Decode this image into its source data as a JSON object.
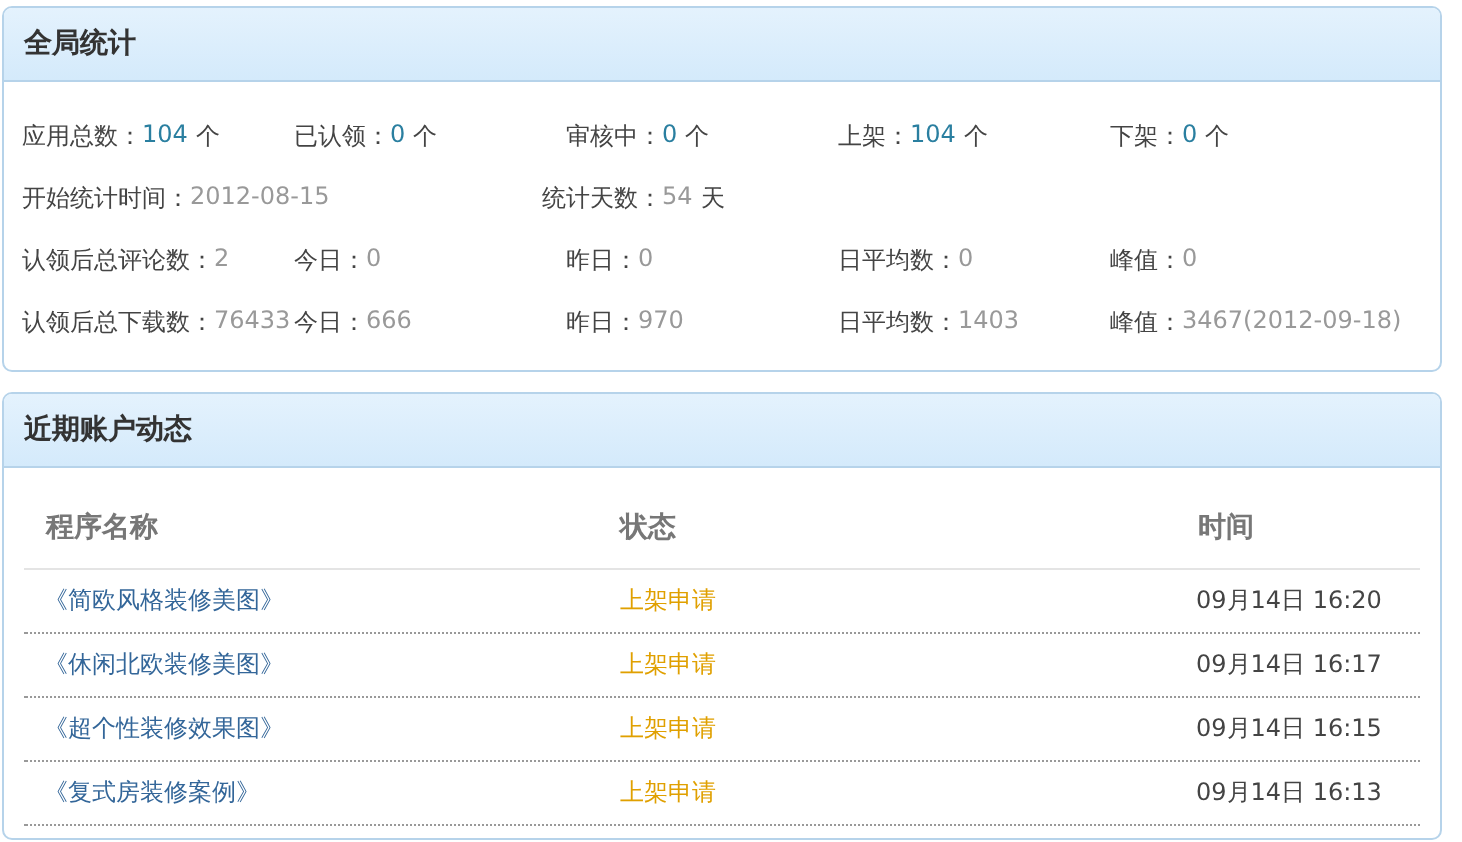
{
  "stats_panel": {
    "title": "全局统计",
    "app_counts": [
      {
        "label": "应用总数：",
        "value": "104",
        "unit": "个"
      },
      {
        "label": "已认领：",
        "value": "0",
        "unit": "个"
      },
      {
        "label": "审核中：",
        "value": "0",
        "unit": "个"
      },
      {
        "label": "上架：",
        "value": "104",
        "unit": "个"
      },
      {
        "label": "下架：",
        "value": "0",
        "unit": "个"
      }
    ],
    "period": {
      "start_label": "开始统计时间：",
      "start_date": "2012-08-15",
      "days_label": "统计天数：",
      "days": "54",
      "days_unit": "天"
    },
    "comments": [
      {
        "label": "认领后总评论数：",
        "value": "2"
      },
      {
        "label": "今日：",
        "value": "0"
      },
      {
        "label": "昨日：",
        "value": "0"
      },
      {
        "label": "日平均数：",
        "value": "0"
      },
      {
        "label": "峰值：",
        "value": "0"
      }
    ],
    "downloads": [
      {
        "label": "认领后总下载数：",
        "value": "76433"
      },
      {
        "label": "今日：",
        "value": "666"
      },
      {
        "label": "昨日：",
        "value": "970"
      },
      {
        "label": "日平均数：",
        "value": "1403"
      },
      {
        "label": "峰值：",
        "value": "3467(2012-09-18)"
      }
    ]
  },
  "activity_panel": {
    "title": "近期账户动态",
    "columns": [
      "程序名称",
      "状态",
      "时间"
    ],
    "rows": [
      {
        "name": "《简欧风格装修美图》",
        "status": "上架申请",
        "time": "09月14日 16:20"
      },
      {
        "name": "《休闲北欧装修美图》",
        "status": "上架申请",
        "time": "09月14日 16:17"
      },
      {
        "name": "《超个性装修效果图》",
        "status": "上架申请",
        "time": "09月14日 16:15"
      },
      {
        "name": "《复式房装修案例》",
        "status": "上架申请",
        "time": "09月14日 16:13"
      }
    ]
  }
}
